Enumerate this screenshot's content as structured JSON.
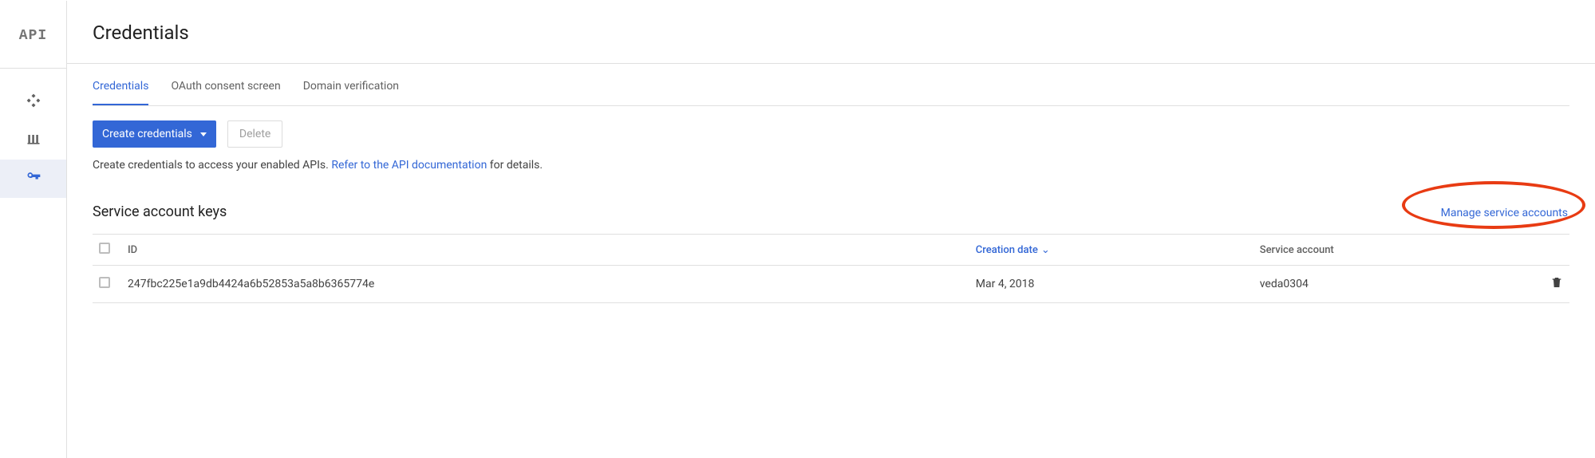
{
  "sidebar": {
    "logo": "API"
  },
  "header": {
    "title": "Credentials"
  },
  "tabs": {
    "credentials": "Credentials",
    "oauth": "OAuth consent screen",
    "domain": "Domain verification"
  },
  "toolbar": {
    "create": "Create credentials",
    "delete": "Delete"
  },
  "helper": {
    "prefix": "Create credentials to access your enabled APIs. ",
    "link": "Refer to the API documentation",
    "suffix": " for details."
  },
  "section": {
    "title": "Service account keys",
    "manage": "Manage service accounts"
  },
  "table": {
    "heads": {
      "id": "ID",
      "created": "Creation date",
      "sa": "Service account"
    },
    "rows": [
      {
        "id": "247fbc225e1a9db4424a6b52853a5a8b6365774e",
        "created": "Mar 4, 2018",
        "sa": "veda0304"
      }
    ]
  }
}
